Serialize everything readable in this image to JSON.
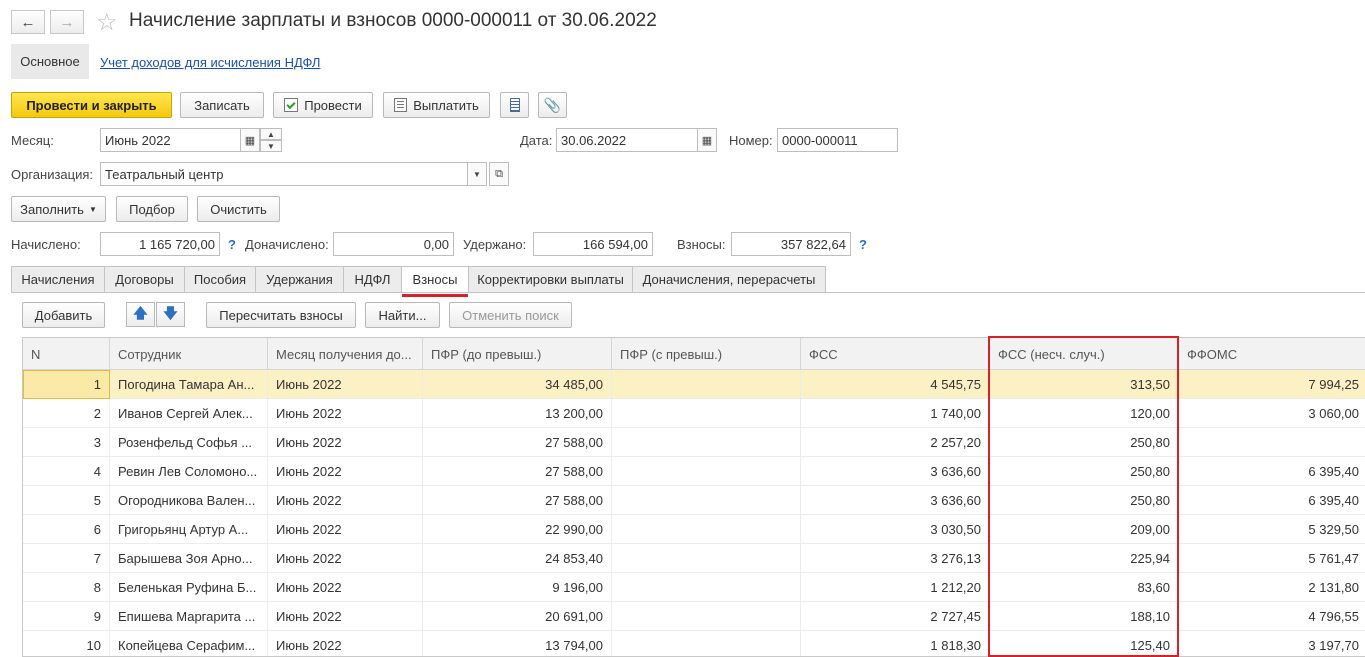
{
  "header": {
    "title": "Начисление зарплаты и взносов 0000-000011 от 30.06.2022",
    "back_icon": "←",
    "forward_icon": "→",
    "star_icon": "☆"
  },
  "sections": {
    "main": "Основное",
    "link": "Учет доходов для исчисления НДФЛ"
  },
  "toolbar": {
    "post_close": "Провести и закрыть",
    "save": "Записать",
    "post": "Провести",
    "pay": "Выплатить"
  },
  "form": {
    "month_label": "Месяц:",
    "month_value": "Июнь 2022",
    "date_label": "Дата:",
    "date_value": "30.06.2022",
    "number_label": "Номер:",
    "number_value": "0000-000011",
    "org_label": "Организация:",
    "org_value": "Театральный центр"
  },
  "actions": {
    "fill": "Заполнить",
    "select": "Подбор",
    "clear": "Очистить"
  },
  "totals": {
    "accrued_label": "Начислено:",
    "accrued_value": "1 165 720,00",
    "additional_label": "Доначислено:",
    "additional_value": "0,00",
    "withheld_label": "Удержано:",
    "withheld_value": "166 594,00",
    "contributions_label": "Взносы:",
    "contributions_value": "357 822,64",
    "help": "?"
  },
  "tabs": [
    "Начисления",
    "Договоры",
    "Пособия",
    "Удержания",
    "НДФЛ",
    "Взносы",
    "Корректировки выплаты",
    "Доначисления, перерасчеты"
  ],
  "grid_toolbar": {
    "add": "Добавить",
    "recalc": "Пересчитать взносы",
    "find": "Найти...",
    "cancel_search": "Отменить поиск"
  },
  "table": {
    "columns": [
      "N",
      "Сотрудник",
      "Месяц получения до...",
      "ПФР (до превыш.)",
      "ПФР (с превыш.)",
      "ФСС",
      "ФСС (несч. случ.)",
      "ФФОМС"
    ],
    "rows": [
      {
        "n": "1",
        "employee": "Погодина Тамара Ан...",
        "month": "Июнь 2022",
        "pfr": "34 485,00",
        "pfr_over": "",
        "fss": "4 545,75",
        "fss_ns": "313,50",
        "ffoms": "7 994,25"
      },
      {
        "n": "2",
        "employee": "Иванов Сергей Алек...",
        "month": "Июнь 2022",
        "pfr": "13 200,00",
        "pfr_over": "",
        "fss": "1 740,00",
        "fss_ns": "120,00",
        "ffoms": "3 060,00"
      },
      {
        "n": "3",
        "employee": "Розенфельд Софья ...",
        "month": "Июнь 2022",
        "pfr": "27 588,00",
        "pfr_over": "",
        "fss": "2 257,20",
        "fss_ns": "250,80",
        "ffoms": ""
      },
      {
        "n": "4",
        "employee": "Ревин Лев Соломоно...",
        "month": "Июнь 2022",
        "pfr": "27 588,00",
        "pfr_over": "",
        "fss": "3 636,60",
        "fss_ns": "250,80",
        "ffoms": "6 395,40"
      },
      {
        "n": "5",
        "employee": "Огородникова Вален...",
        "month": "Июнь 2022",
        "pfr": "27 588,00",
        "pfr_over": "",
        "fss": "3 636,60",
        "fss_ns": "250,80",
        "ffoms": "6 395,40"
      },
      {
        "n": "6",
        "employee": "Григорьянц Артур А...",
        "month": "Июнь 2022",
        "pfr": "22 990,00",
        "pfr_over": "",
        "fss": "3 030,50",
        "fss_ns": "209,00",
        "ffoms": "5 329,50"
      },
      {
        "n": "7",
        "employee": "Барышева Зоя Арно...",
        "month": "Июнь 2022",
        "pfr": "24 853,40",
        "pfr_over": "",
        "fss": "3 276,13",
        "fss_ns": "225,94",
        "ffoms": "5 761,47"
      },
      {
        "n": "8",
        "employee": "Беленькая Руфина Б...",
        "month": "Июнь 2022",
        "pfr": "9 196,00",
        "pfr_over": "",
        "fss": "1 212,20",
        "fss_ns": "83,60",
        "ffoms": "2 131,80"
      },
      {
        "n": "9",
        "employee": "Епишева Маргарита ...",
        "month": "Июнь 2022",
        "pfr": "20 691,00",
        "pfr_over": "",
        "fss": "2 727,45",
        "fss_ns": "188,10",
        "ffoms": "4 796,55"
      },
      {
        "n": "10",
        "employee": "Копейцева Серафим...",
        "month": "Июнь 2022",
        "pfr": "13 794,00",
        "pfr_over": "",
        "fss": "1 818,30",
        "fss_ns": "125,40",
        "ffoms": "3 197,70"
      }
    ]
  },
  "colors": {
    "primary_button": "#f4c90c",
    "highlight_frame": "#d9202a",
    "selected_row": "#fbf1c4",
    "link": "#1a4fae"
  }
}
